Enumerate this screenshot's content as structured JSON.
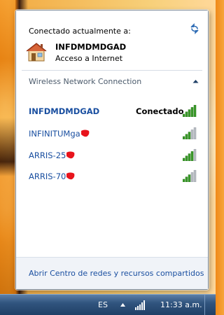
{
  "popup": {
    "header": "Conectado actualmente a:",
    "current": {
      "name": "INFDMDMDGAD",
      "status": "Acceso a Internet"
    },
    "group_title": "Wireless Network Connection",
    "networks": [
      {
        "name": "INFDMDMDGAD",
        "state": "Conectado",
        "signal_bars": 5,
        "connected": true,
        "redacted": false
      },
      {
        "name": "INFINITUMga",
        "state": "",
        "signal_bars": 3,
        "connected": false,
        "redacted": true
      },
      {
        "name": "ARRIS-25",
        "state": "",
        "signal_bars": 4,
        "connected": false,
        "redacted": true
      },
      {
        "name": "ARRIS-70",
        "state": "",
        "signal_bars": 3,
        "connected": false,
        "redacted": true
      }
    ],
    "footer_link": "Abrir Centro de redes y recursos compartidos"
  },
  "taskbar": {
    "language": "ES",
    "clock": "11:33 a.m."
  },
  "colors": {
    "link": "#1a4fa0",
    "signal_on": "#3a9a2a",
    "signal_off": "#b8bcc2",
    "redaction": "#e8141c"
  },
  "icons": {
    "refresh": "refresh-icon",
    "network": "house-network-icon",
    "collapse": "chevron-up-icon",
    "signal": "wifi-signal-icon"
  }
}
